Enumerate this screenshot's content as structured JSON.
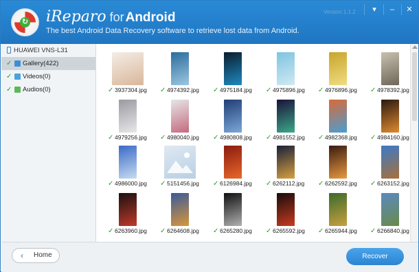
{
  "header": {
    "brand": "iReparo",
    "for_word": "for",
    "platform": "Android",
    "subtitle": "The best Android Data Recovery software to retrieve lost data from Android.",
    "version": "Version 1.1.2",
    "window_buttons": {
      "menu": "▾",
      "minimize": "–",
      "close": "✕"
    },
    "accent_color": "#2a84d2"
  },
  "sidebar": {
    "device": "HUAWEI VNS-L31",
    "items": [
      {
        "label": "Gallery(422)",
        "checked": true,
        "selected": true,
        "icon": "gallery-icon",
        "color": "#3f8fd6"
      },
      {
        "label": "Videos(0)",
        "checked": true,
        "selected": false,
        "icon": "video-icon",
        "color": "#4aa3e0"
      },
      {
        "label": "Audios(0)",
        "checked": true,
        "selected": false,
        "icon": "audio-icon",
        "color": "#5cb85c"
      }
    ]
  },
  "gallery": {
    "check_glyph": "✓",
    "files": [
      {
        "name": "3937304.jpg",
        "shape": "square",
        "colors": [
          "#f4ede6",
          "#d9b79a"
        ]
      },
      {
        "name": "4974392.jpg",
        "shape": "portrait",
        "colors": [
          "#2c6c9c",
          "#9cc6e0"
        ]
      },
      {
        "name": "4975184.jpg",
        "shape": "portrait",
        "colors": [
          "#0b1c2c",
          "#1f8ac0"
        ]
      },
      {
        "name": "4975896.jpg",
        "shape": "portrait",
        "colors": [
          "#7ec4e0",
          "#cfe9f3"
        ]
      },
      {
        "name": "4976896.jpg",
        "shape": "portrait",
        "colors": [
          "#c8a52c",
          "#f0dc80"
        ]
      },
      {
        "name": "4978392.jpg",
        "shape": "portrait",
        "colors": [
          "#c8c0b0",
          "#6e6658"
        ]
      },
      {
        "name": "4979256.jpg",
        "shape": "portrait",
        "colors": [
          "#9a9aa2",
          "#e8e8ea"
        ]
      },
      {
        "name": "4980040.jpg",
        "shape": "portrait",
        "colors": [
          "#e6e6e6",
          "#c46a80"
        ]
      },
      {
        "name": "4980808.jpg",
        "shape": "portrait",
        "colors": [
          "#203e74",
          "#7da8d8"
        ]
      },
      {
        "name": "4981552.jpg",
        "shape": "portrait",
        "colors": [
          "#1a1238",
          "#3ca88a"
        ]
      },
      {
        "name": "4982368.jpg",
        "shape": "portrait",
        "colors": [
          "#d86a3a",
          "#4a9ed0"
        ]
      },
      {
        "name": "4984160.jpg",
        "shape": "portrait",
        "colors": [
          "#2a1a10",
          "#e08a30"
        ]
      },
      {
        "name": "4986000.jpg",
        "shape": "portrait",
        "colors": [
          "#3a6ac8",
          "#c8dcf0"
        ]
      },
      {
        "name": "5151456.jpg",
        "shape": "square",
        "colors": [
          "#dfe9f3",
          "#b9cfe3"
        ]
      },
      {
        "name": "6126984.jpg",
        "shape": "portrait",
        "colors": [
          "#8a1a10",
          "#e8682a"
        ]
      },
      {
        "name": "6262112.jpg",
        "shape": "portrait",
        "colors": [
          "#18203a",
          "#d8a040"
        ]
      },
      {
        "name": "6262592.jpg",
        "shape": "portrait",
        "colors": [
          "#3a1a10",
          "#e89a40"
        ]
      },
      {
        "name": "6263152.jpg",
        "shape": "portrait",
        "colors": [
          "#3a7ac8",
          "#a8703a"
        ]
      },
      {
        "name": "6263960.jpg",
        "shape": "portrait",
        "colors": [
          "#1a1010",
          "#c03a2a"
        ]
      },
      {
        "name": "6264608.jpg",
        "shape": "portrait",
        "colors": [
          "#3a5a9a",
          "#d8963a"
        ]
      },
      {
        "name": "6265280.jpg",
        "shape": "portrait",
        "colors": [
          "#101010",
          "#b0b0b0"
        ]
      },
      {
        "name": "6265592.jpg",
        "shape": "portrait",
        "colors": [
          "#180c0c",
          "#c83a20"
        ]
      },
      {
        "name": "6265944.jpg",
        "shape": "portrait",
        "colors": [
          "#3a6a2a",
          "#c8a040"
        ]
      },
      {
        "name": "6266840.jpg",
        "shape": "portrait",
        "colors": [
          "#5a8ac0",
          "#6a8a4a"
        ]
      }
    ]
  },
  "footer": {
    "home_label": "Home",
    "home_arrow": "‹",
    "recover_label": "Recover"
  }
}
